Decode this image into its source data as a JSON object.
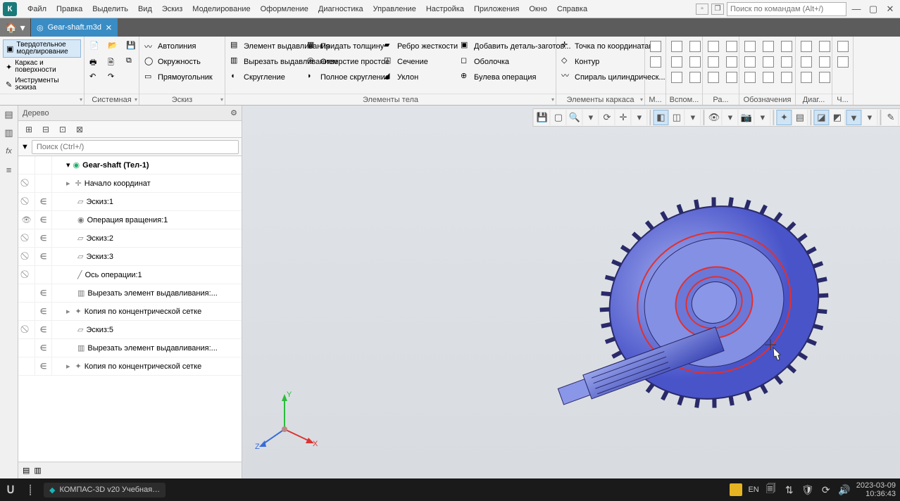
{
  "menubar": {
    "items": [
      "Файл",
      "Правка",
      "Выделить",
      "Вид",
      "Эскиз",
      "Моделирование",
      "Оформление",
      "Диагностика",
      "Управление",
      "Настройка",
      "Приложения",
      "Окно",
      "Справка"
    ],
    "search_placeholder": "Поиск по командам (Alt+/)"
  },
  "doctab": {
    "name": "Gear-shaft.m3d"
  },
  "ribbon": {
    "modes": {
      "solid": "Твердотельное моделирование",
      "wire": "Каркас и поверхности",
      "sketch_tools": "Инструменты эскиза"
    },
    "groups": {
      "system": "Системная",
      "sketch": {
        "label": "Эскиз",
        "autoline": "Автолиния",
        "circle": "Окружность",
        "rect": "Прямоугольник",
        "fillet": "Скругление"
      },
      "body_elements": {
        "label": "Элементы тела",
        "extrude": "Элемент выдавливания",
        "cut": "Вырезать выдавливанием",
        "thicken": "Придать толщину",
        "hole": "Отверстие простое",
        "full_fillet": "Полное скругление",
        "rib": "Ребро жесткости",
        "section": "Сечение",
        "draft": "Уклон",
        "add_blank": "Добавить деталь-заготов...",
        "shell": "Оболочка",
        "boolean": "Булева операция"
      },
      "frame": {
        "label": "Элементы каркаса",
        "point": "Точка по координатам",
        "contour": "Контур",
        "helix": "Спираль цилиндрическ..."
      },
      "short": {
        "m": "М...",
        "aux": "Вспом...",
        "r": "Ра...",
        "notation": "Обозначения",
        "diag": "Диаг...",
        "ch": "Ч..."
      }
    }
  },
  "tree": {
    "title": "Дерево",
    "search_placeholder": "Поиск (Ctrl+/)",
    "root": "Gear-shaft (Тел-1)",
    "items": [
      {
        "eye": "hide",
        "in": "",
        "indent": 1,
        "icon": "origin",
        "label": "Начало координат",
        "expander": "▸"
      },
      {
        "eye": "hide",
        "in": "∈",
        "indent": 2,
        "icon": "sketch",
        "label": "Эскиз:1"
      },
      {
        "eye": "show",
        "in": "∈",
        "indent": 2,
        "icon": "revolve",
        "label": "Операция вращения:1"
      },
      {
        "eye": "hide",
        "in": "∈",
        "indent": 2,
        "icon": "sketch",
        "label": "Эскиз:2"
      },
      {
        "eye": "hide",
        "in": "∈",
        "indent": 2,
        "icon": "sketch",
        "label": "Эскиз:3"
      },
      {
        "eye": "hide",
        "in": "",
        "indent": 2,
        "icon": "axis",
        "label": "Ось операции:1"
      },
      {
        "eye": "",
        "in": "∈",
        "indent": 2,
        "icon": "cut",
        "label": "Вырезать элемент выдавливания:..."
      },
      {
        "eye": "",
        "in": "∈",
        "indent": 1,
        "icon": "pattern",
        "label": "Копия по концентрической сетке",
        "expander": "▸"
      },
      {
        "eye": "hide",
        "in": "∈",
        "indent": 2,
        "icon": "sketch",
        "label": "Эскиз:5"
      },
      {
        "eye": "",
        "in": "∈",
        "indent": 2,
        "icon": "cut",
        "label": "Вырезать элемент выдавливания:..."
      },
      {
        "eye": "",
        "in": "∈",
        "indent": 1,
        "icon": "pattern",
        "label": "Копия по концентрической сетке",
        "expander": "▸"
      }
    ]
  },
  "triad": {
    "x": "X",
    "y": "Y",
    "z": "Z"
  },
  "taskbar": {
    "app_title": "КОМПАС-3D v20 Учебная…",
    "lang": "EN",
    "date": "2023-03-09",
    "time": "10:36:43"
  }
}
